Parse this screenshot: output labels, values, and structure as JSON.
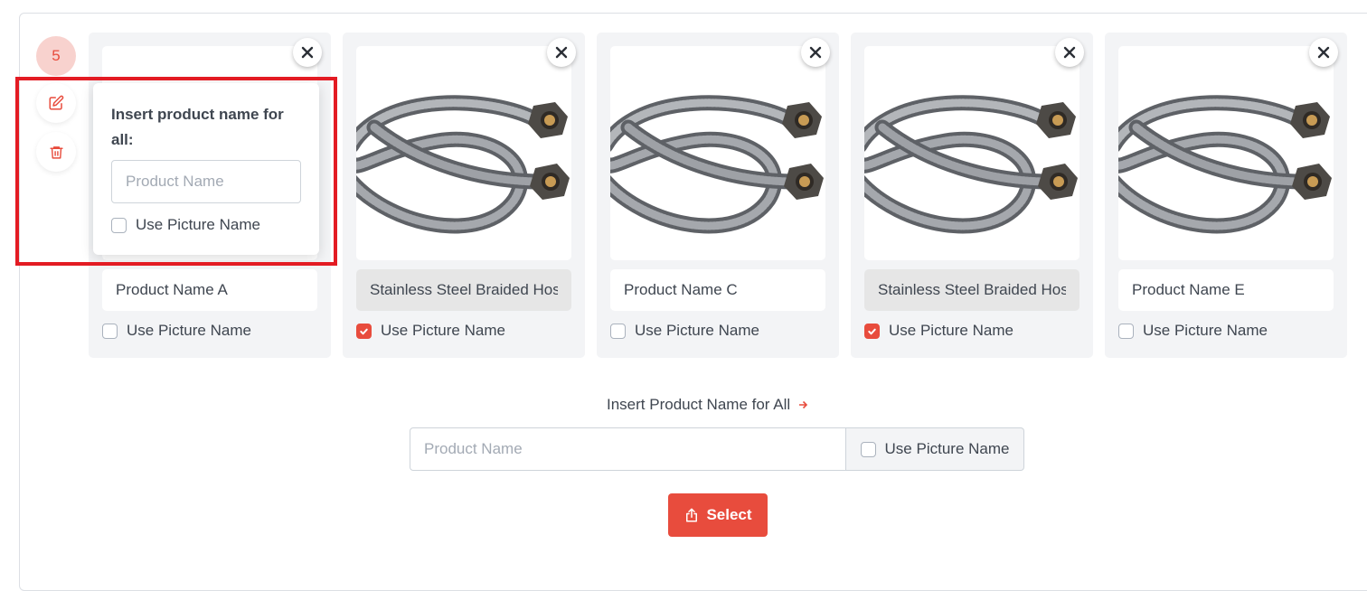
{
  "sidebar": {
    "count": "5",
    "edit_icon": "edit-icon",
    "delete_icon": "trash-icon"
  },
  "popover": {
    "title": "Insert product name for all:",
    "input_placeholder": "Product Name",
    "input_value": "",
    "checkbox_label": "Use Picture Name",
    "checkbox_checked": false
  },
  "cards": [
    {
      "name_value": "Product Name A",
      "use_picture_name": false,
      "checkbox_label": "Use Picture Name",
      "has_image": false
    },
    {
      "name_value": "Stainless Steel Braided Hose",
      "use_picture_name": true,
      "checkbox_label": "Use Picture Name",
      "has_image": true
    },
    {
      "name_value": "Product Name C",
      "use_picture_name": false,
      "checkbox_label": "Use Picture Name",
      "has_image": true
    },
    {
      "name_value": "Stainless Steel Braided Hose",
      "use_picture_name": true,
      "checkbox_label": "Use Picture Name",
      "has_image": true
    },
    {
      "name_value": "Product Name E",
      "use_picture_name": false,
      "checkbox_label": "Use Picture Name",
      "has_image": true
    }
  ],
  "bulk": {
    "label": "Insert Product Name for All",
    "arrow_icon": "arrow-right-icon",
    "input_placeholder": "Product Name",
    "input_value": "",
    "checkbox_label": "Use Picture Name",
    "checkbox_checked": false
  },
  "select_button": {
    "label": "Select",
    "icon": "share-upload-icon"
  },
  "colors": {
    "accent": "#e84c3d",
    "highlight": "#e31b23",
    "card_bg": "#f3f4f6",
    "badge_bg": "#f8d2ce"
  }
}
